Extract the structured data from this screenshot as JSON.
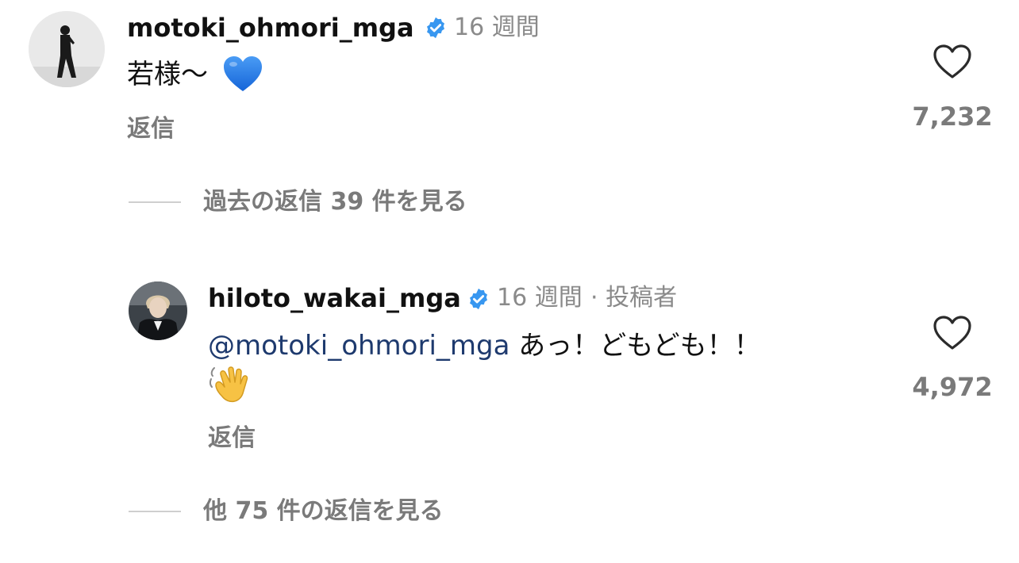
{
  "comments": [
    {
      "username": "motoki_ohmori_mga",
      "verified": true,
      "time": "16 週間",
      "text": "若様〜",
      "emoji": "blue-heart",
      "reply_label": "返信",
      "likes": "7,232",
      "view_replies": "過去の返信 39 件を見る"
    },
    {
      "username": "hiloto_wakai_mga",
      "verified": true,
      "time": "16 週間",
      "author_tag": "· 投稿者",
      "mention": "@motoki_ohmori_mga",
      "text": " あっ！どもども！！",
      "emoji": "waving-hand",
      "reply_label": "返信",
      "likes": "4,972",
      "view_replies": "他 75 件の返信を見る"
    }
  ],
  "colors": {
    "verified_blue": "#3897f0",
    "mention_blue": "#1e3a6e",
    "secondary_gray": "#7a7a7a",
    "heart_emoji": "#1a73e8"
  }
}
